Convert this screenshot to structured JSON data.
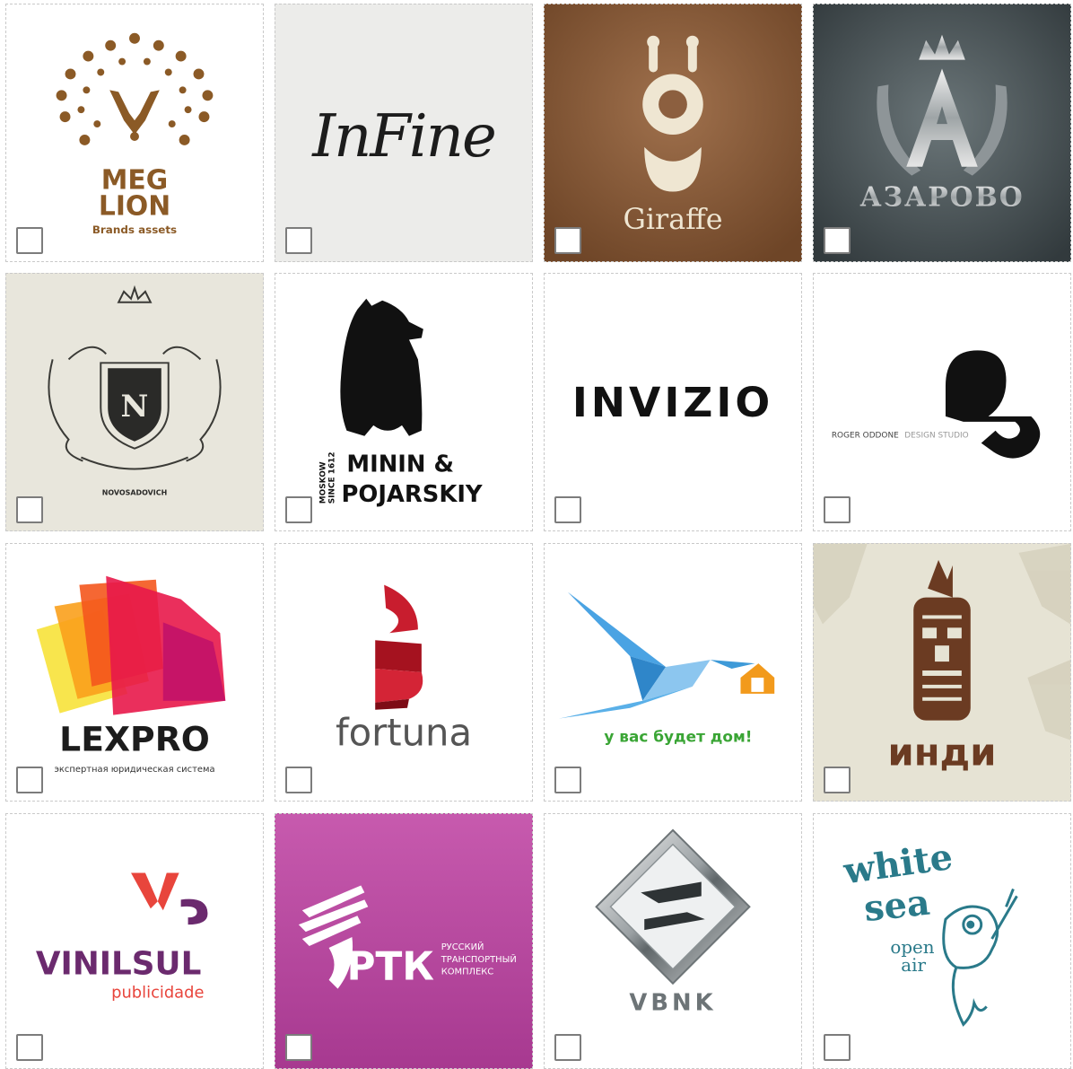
{
  "tiles": [
    {
      "id": "megalion",
      "wordmark": [
        "MEG",
        "LION"
      ],
      "tagline": "Brands assets",
      "bg": "#ffffff",
      "accent": "#8b5a26",
      "checked": false
    },
    {
      "id": "infine",
      "wordmark": "InFine",
      "bg": "#ececea",
      "checked": false
    },
    {
      "id": "giraffe",
      "wordmark": "Giraffe",
      "bg": "#8c5f3f",
      "accent": "#efe6d2",
      "checked": false
    },
    {
      "id": "azarovo",
      "wordmark": "АЗАРОВО",
      "bg": "#4a5457",
      "checked": false
    },
    {
      "id": "novosadovich",
      "wordmark": "NOVOSADOVICH",
      "bg": "#e8e6dc",
      "checked": false
    },
    {
      "id": "minin",
      "wordmark": [
        "MININ &",
        "POJARSKIY"
      ],
      "side_text": [
        "MOSKOW",
        "SINCE 1612"
      ],
      "bg": "#ffffff",
      "checked": false
    },
    {
      "id": "invizio",
      "wordmark": "INVIZIO",
      "bg": "#ffffff",
      "checked": false
    },
    {
      "id": "rogeroddone",
      "wordmark": "ROGER ODDONE",
      "wordmark_light": "DESIGN STUDIO",
      "bg": "#ffffff",
      "checked": false
    },
    {
      "id": "lexpro",
      "wordmark": "LEXPRO",
      "tagline": "экспертная юридическая система",
      "bg": "#ffffff",
      "checked": false
    },
    {
      "id": "fortuna",
      "wordmark": "fortuna",
      "bg": "#ffffff",
      "accent": "#c81d2e",
      "checked": false
    },
    {
      "id": "dom",
      "wordmark": "у вас будет дом!",
      "bg": "#ffffff",
      "accent": "#3e9ad8",
      "checked": false
    },
    {
      "id": "indi",
      "wordmark": "инди",
      "bg": "#e6e3d4",
      "accent": "#6b3b22",
      "checked": false
    },
    {
      "id": "vinilsul",
      "wordmark": "VINILSUL",
      "tagline": "publicidade",
      "bg": "#ffffff",
      "accent": "#6b2a6e",
      "checked": false
    },
    {
      "id": "rtk",
      "wordmark": "РТК",
      "tagline": [
        "РУССКИЙ",
        "ТРАНСПОРТНЫЙ",
        "КОМПЛЕКС"
      ],
      "bg": "#b8449e",
      "checked": false
    },
    {
      "id": "vbnk",
      "wordmark": "VBNK",
      "bg": "#ffffff",
      "checked": false
    },
    {
      "id": "whitesea",
      "wordmark": [
        "white",
        "sea"
      ],
      "tagline": [
        "open",
        "air"
      ],
      "bg": "#ffffff",
      "accent": "#2a7a8a",
      "checked": false
    }
  ]
}
